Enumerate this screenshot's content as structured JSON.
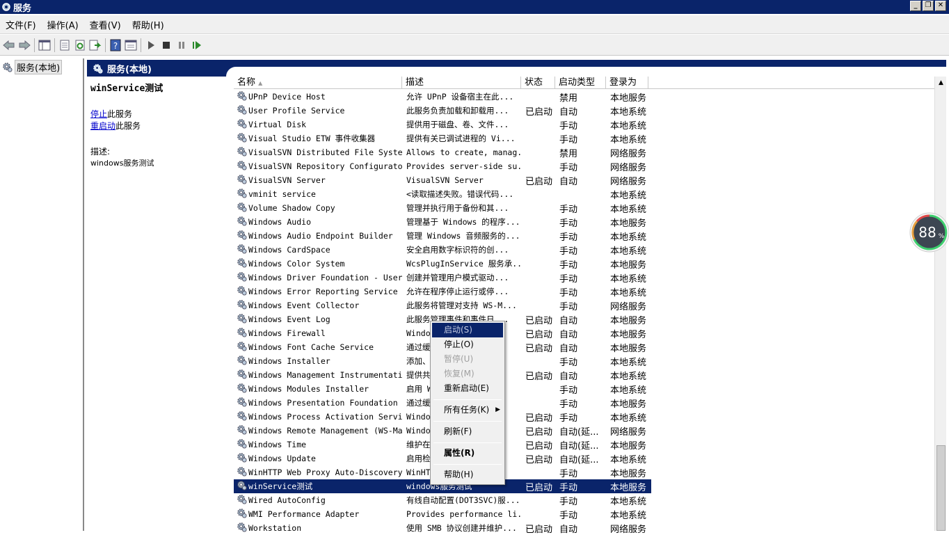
{
  "window": {
    "title": "服务"
  },
  "menu": [
    "文件(F)",
    "操作(A)",
    "查看(V)",
    "帮助(H)"
  ],
  "toolbar": [
    "back-icon",
    "forward-icon",
    "console-tree-icon",
    "export-list-icon",
    "refresh-icon",
    "export-icon",
    "help-icon",
    "properties-icon",
    "play-icon",
    "stop-icon",
    "pause-icon",
    "restart-icon"
  ],
  "tree": {
    "root": "服务(本地)"
  },
  "pane": {
    "title": "服务(本地)"
  },
  "detail": {
    "service_name": "winService测试",
    "stop_link": "停止",
    "stop_suffix": "此服务",
    "restart_link": "重启动",
    "restart_suffix": "此服务",
    "desc_label": "描述:",
    "desc_text": "windows服务测试"
  },
  "columns": [
    "名称",
    "描述",
    "状态",
    "启动类型",
    "登录为"
  ],
  "services": [
    {
      "name": "UPnP Device Host",
      "desc": "允许 UPnP 设备宿主在此...",
      "status": "",
      "startup": "禁用",
      "logon": "本地服务"
    },
    {
      "name": "User Profile Service",
      "desc": "此服务负责加载和卸载用...",
      "status": "已启动",
      "startup": "自动",
      "logon": "本地系统"
    },
    {
      "name": "Virtual Disk",
      "desc": "提供用于磁盘、卷、文件...",
      "status": "",
      "startup": "手动",
      "logon": "本地系统"
    },
    {
      "name": "Visual Studio ETW 事件收集器",
      "desc": "提供有关已调试进程的 Vi...",
      "status": "",
      "startup": "手动",
      "logon": "本地系统"
    },
    {
      "name": "VisualSVN Distributed File System...",
      "desc": "Allows to create, manag...",
      "status": "",
      "startup": "禁用",
      "logon": "网络服务"
    },
    {
      "name": "VisualSVN Repository Configurator...",
      "desc": "Provides server-side su...",
      "status": "",
      "startup": "手动",
      "logon": "网络服务"
    },
    {
      "name": "VisualSVN Server",
      "desc": "VisualSVN Server",
      "status": "已启动",
      "startup": "自动",
      "logon": "网络服务"
    },
    {
      "name": "vminit service",
      "desc": "<读取描述失败。错误代码...",
      "status": "",
      "startup": "",
      "logon": "本地系统"
    },
    {
      "name": "Volume Shadow Copy",
      "desc": "管理并执行用于备份和其...",
      "status": "",
      "startup": "手动",
      "logon": "本地系统"
    },
    {
      "name": "Windows Audio",
      "desc": "管理基于 Windows 的程序...",
      "status": "",
      "startup": "手动",
      "logon": "本地服务"
    },
    {
      "name": "Windows Audio Endpoint Builder",
      "desc": "管理 Windows 音频服务的...",
      "status": "",
      "startup": "手动",
      "logon": "本地系统"
    },
    {
      "name": "Windows CardSpace",
      "desc": "安全启用数字标识符的创...",
      "status": "",
      "startup": "手动",
      "logon": "本地系统"
    },
    {
      "name": "Windows Color System",
      "desc": "WcsPlugInService 服务承...",
      "status": "",
      "startup": "手动",
      "logon": "本地服务"
    },
    {
      "name": "Windows Driver Foundation - User-...",
      "desc": "创建并管理用户模式驱动...",
      "status": "",
      "startup": "手动",
      "logon": "本地系统"
    },
    {
      "name": "Windows Error Reporting Service",
      "desc": "允许在程序停止运行或停...",
      "status": "",
      "startup": "手动",
      "logon": "本地系统"
    },
    {
      "name": "Windows Event Collector",
      "desc": "此服务将管理对支持 WS-M...",
      "status": "",
      "startup": "手动",
      "logon": "网络服务"
    },
    {
      "name": "Windows Event Log",
      "desc": "此服务管理事件和事件日...",
      "status": "已启动",
      "startup": "自动",
      "logon": "本地服务"
    },
    {
      "name": "Windows Firewall",
      "desc": "Windows ...",
      "status": "已启动",
      "startup": "自动",
      "logon": "本地服务"
    },
    {
      "name": "Windows Font Cache Service",
      "desc": "通过缓...",
      "status": "已启动",
      "startup": "自动",
      "logon": "本地服务"
    },
    {
      "name": "Windows Installer",
      "desc": "添加、...",
      "status": "",
      "startup": "手动",
      "logon": "本地系统"
    },
    {
      "name": "Windows Management Instrumentation",
      "desc": "提供共...",
      "status": "已启动",
      "startup": "自动",
      "logon": "本地系统"
    },
    {
      "name": "Windows Modules Installer",
      "desc": "启用 W...",
      "status": "",
      "startup": "手动",
      "logon": "本地系统"
    },
    {
      "name": "Windows Presentation Foundation F...",
      "desc": "通过缓...",
      "status": "",
      "startup": "手动",
      "logon": "本地服务"
    },
    {
      "name": "Windows Process Activation Service",
      "desc": "Windo...",
      "status": "已启动",
      "startup": "手动",
      "logon": "本地系统"
    },
    {
      "name": "Windows Remote Management (WS-Man...",
      "desc": "Windo...",
      "status": "已启动",
      "startup": "自动(延...",
      "logon": "网络服务"
    },
    {
      "name": "Windows Time",
      "desc": "维护在...",
      "status": "已启动",
      "startup": "自动(延...",
      "logon": "本地服务"
    },
    {
      "name": "Windows Update",
      "desc": "启用检...",
      "status": "已启动",
      "startup": "自动(延...",
      "logon": "本地系统"
    },
    {
      "name": "WinHTTP Web Proxy Auto-Discovery ...",
      "desc": "WinHT...",
      "status": "",
      "startup": "手动",
      "logon": "本地服务"
    },
    {
      "name": "winService测试",
      "desc": "windows服务测试",
      "status": "已启动",
      "startup": "手动",
      "logon": "本地服务",
      "selected": true
    },
    {
      "name": "Wired AutoConfig",
      "desc": "有线自动配置(DOT3SVC)服...",
      "status": "",
      "startup": "手动",
      "logon": "本地系统"
    },
    {
      "name": "WMI Performance Adapter",
      "desc": "Provides performance li...",
      "status": "",
      "startup": "手动",
      "logon": "本地系统"
    },
    {
      "name": "Workstation",
      "desc": "使用 SMB 协议创建并维护...",
      "status": "已启动",
      "startup": "自动",
      "logon": "网络服务"
    }
  ],
  "context_menu": {
    "start": "启动(S)",
    "stop": "停止(O)",
    "pause": "暂停(U)",
    "resume": "恢复(M)",
    "restart": "重新启动(E)",
    "all_tasks": "所有任务(K)",
    "refresh": "刷新(F)",
    "properties": "属性(R)",
    "help": "帮助(H)"
  },
  "gauge": {
    "value": "88",
    "unit": "%"
  },
  "colors": {
    "selection": "#0a246a",
    "link": "#0000cc"
  }
}
